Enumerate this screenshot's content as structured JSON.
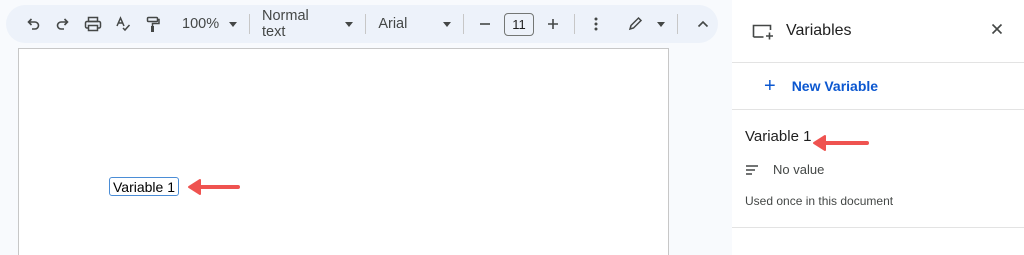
{
  "toolbar": {
    "zoom": "100%",
    "style": "Normal text",
    "font": "Arial",
    "font_size": "11",
    "icons": [
      "undo-icon",
      "redo-icon",
      "print-icon",
      "spellcheck-icon",
      "paint-format-icon",
      "more-vert-icon",
      "pencil-edit-icon",
      "chevron-up-icon"
    ]
  },
  "document": {
    "variable_chip": "Variable 1"
  },
  "panel": {
    "title": "Variables",
    "new_variable": "New Variable",
    "variable": {
      "name": "Variable 1",
      "value": "No value",
      "usage": "Used once in this document"
    }
  },
  "colors": {
    "accent": "#0b57d0",
    "annotation_arrow": "#ef5350",
    "toolbar_bg": "#edf2fa",
    "chip_border": "#4b8dd6"
  }
}
